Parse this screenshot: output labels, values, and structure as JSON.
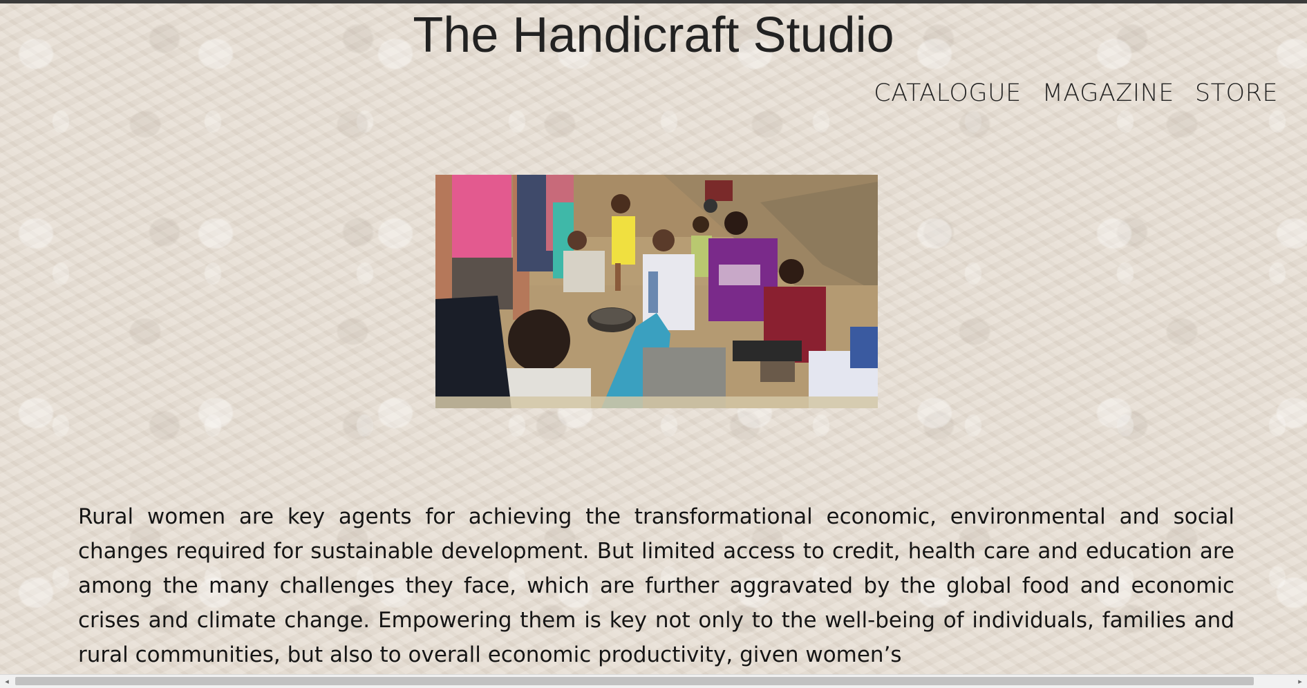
{
  "site": {
    "title": "The Handicraft Studio"
  },
  "nav": {
    "items": [
      {
        "label": "CATALOGUE"
      },
      {
        "label": "MAGAZINE"
      },
      {
        "label": "STORE"
      }
    ]
  },
  "article": {
    "paragraph": "Rural women are key agents for achieving the transformational economic, environmental and social changes required for sustainable development. But limited access to credit, health care and education are among the many challenges they face, which are further aggravated by the global food and economic crises and climate change. Empowering them is key not only to the well-being of individuals, families and rural communities, but also to overall economic productivity, given women’s"
  },
  "scrollbar": {
    "left_arrow": "◂",
    "right_arrow": "▸",
    "thumb_fraction": 0.97
  },
  "colors": {
    "page_background": "#e6ddd2",
    "text": "#1f1f1f"
  }
}
